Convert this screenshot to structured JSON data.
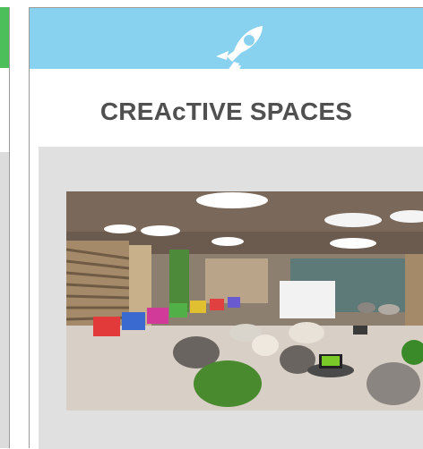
{
  "card": {
    "title": "CREAcTIVE SPACES",
    "icon": "rocket-icon",
    "header_color": "#88d1ef",
    "body_color": "#e0e0e0"
  },
  "left_card": {
    "accent_color": "#4cbe5a"
  },
  "photo": {
    "description_icon": "room-photo"
  }
}
